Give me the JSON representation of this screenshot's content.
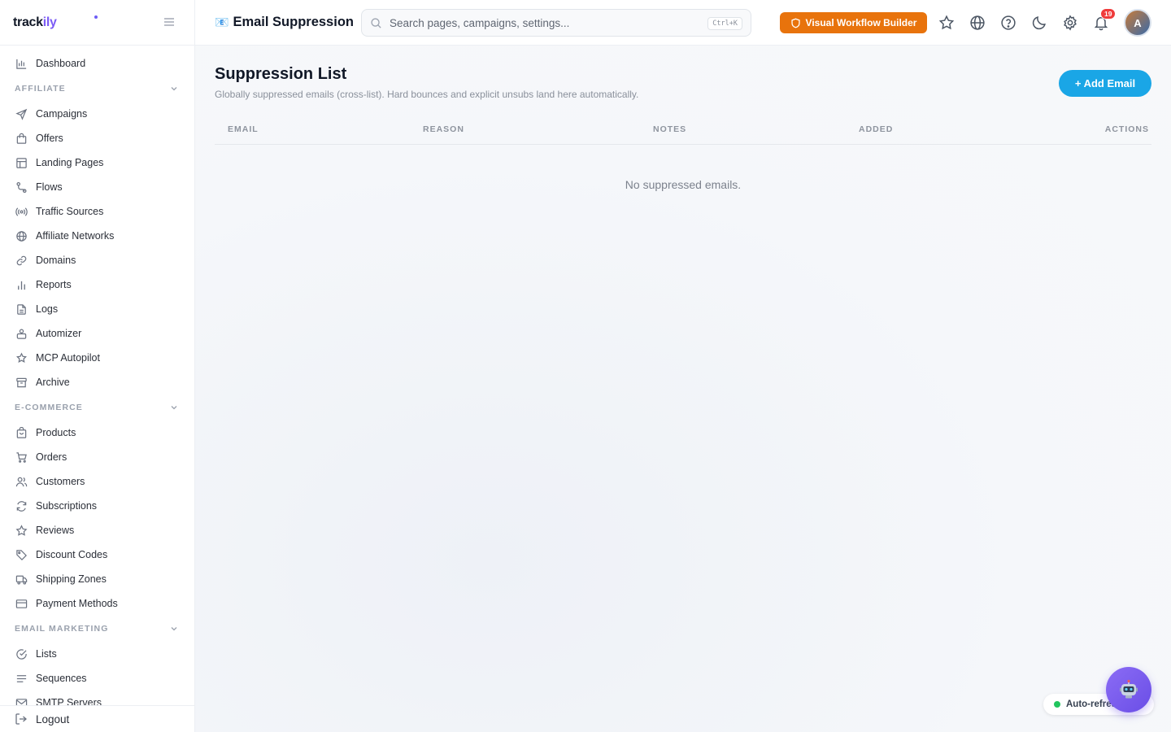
{
  "brand": {
    "name_part1": "track",
    "name_part2": "ily"
  },
  "sidebar": {
    "dashboard": "Dashboard",
    "sections": [
      {
        "title": "AFFILIATE",
        "items": [
          {
            "label": "Campaigns",
            "icon": "send-icon"
          },
          {
            "label": "Offers",
            "icon": "shopping-bag-icon"
          },
          {
            "label": "Landing Pages",
            "icon": "layout-icon"
          },
          {
            "label": "Flows",
            "icon": "route-icon"
          },
          {
            "label": "Traffic Sources",
            "icon": "radio-icon"
          },
          {
            "label": "Affiliate Networks",
            "icon": "globe-icon"
          },
          {
            "label": "Domains",
            "icon": "link-icon"
          },
          {
            "label": "Reports",
            "icon": "bar-chart-icon"
          },
          {
            "label": "Logs",
            "icon": "file-text-icon"
          },
          {
            "label": "Automizer",
            "icon": "bot-icon"
          },
          {
            "label": "MCP Autopilot",
            "icon": "sparkle-icon"
          },
          {
            "label": "Archive",
            "icon": "archive-icon"
          }
        ]
      },
      {
        "title": "E-COMMERCE",
        "items": [
          {
            "label": "Products",
            "icon": "package-icon"
          },
          {
            "label": "Orders",
            "icon": "cart-icon"
          },
          {
            "label": "Customers",
            "icon": "users-icon"
          },
          {
            "label": "Subscriptions",
            "icon": "refresh-icon"
          },
          {
            "label": "Reviews",
            "icon": "star-icon"
          },
          {
            "label": "Discount Codes",
            "icon": "tag-icon"
          },
          {
            "label": "Shipping Zones",
            "icon": "truck-icon"
          },
          {
            "label": "Payment Methods",
            "icon": "credit-card-icon"
          }
        ]
      },
      {
        "title": "EMAIL MARKETING",
        "items": [
          {
            "label": "Lists",
            "icon": "check-circle-icon"
          },
          {
            "label": "Sequences",
            "icon": "lines-icon"
          },
          {
            "label": "SMTP Servers",
            "icon": "mail-icon"
          }
        ]
      }
    ],
    "logout": "Logout"
  },
  "header": {
    "title_emoji": "📧",
    "title": "Email Suppression",
    "search_placeholder": "Search pages, campaigns, settings...",
    "search_shortcut": "Ctrl+K",
    "workflow_button": "Visual Workflow Builder",
    "notification_count": "19",
    "avatar_initial": "A"
  },
  "main": {
    "title": "Suppression List",
    "subtitle": "Globally suppressed emails (cross-list). Hard bounces and explicit unsubs land here automatically.",
    "add_button": "+ Add Email",
    "columns": [
      "EMAIL",
      "REASON",
      "NOTES",
      "ADDED",
      "ACTIONS"
    ],
    "empty_message": "No suppressed emails."
  },
  "floating": {
    "auto_refresh_label": "Auto-refresh"
  },
  "colors": {
    "accent_purple": "#7c5cf5",
    "workflow_orange": "#e8730c",
    "add_button_blue": "#1aa6e6",
    "badge_red": "#ef3b3b",
    "status_green": "#22c55e"
  }
}
